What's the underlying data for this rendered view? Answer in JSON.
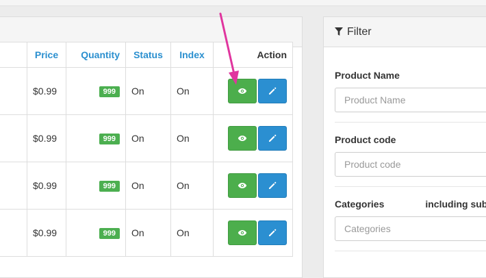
{
  "table": {
    "headers": {
      "price": "Price",
      "quantity": "Quantity",
      "status": "Status",
      "index": "Index",
      "action": "Action"
    },
    "rows": [
      {
        "price": "$0.99",
        "quantity": "999",
        "status": "On",
        "index": "On"
      },
      {
        "price": "$0.99",
        "quantity": "999",
        "status": "On",
        "index": "On"
      },
      {
        "price": "$0.99",
        "quantity": "999",
        "status": "On",
        "index": "On"
      },
      {
        "price": "$0.99",
        "quantity": "999",
        "status": "On",
        "index": "On"
      }
    ]
  },
  "filter": {
    "title": "Filter",
    "product_name": {
      "label": "Product Name",
      "placeholder": "Product Name"
    },
    "product_code": {
      "label": "Product code",
      "placeholder": "Product code"
    },
    "categories": {
      "label": "Categories",
      "sub_label": "including sub",
      "placeholder": "Categories"
    }
  },
  "colors": {
    "link_header": "#2a8fcf",
    "view_button": "#4cae4c",
    "edit_button": "#2b8fd1",
    "badge": "#4caf50",
    "annotation_arrow": "#e0359e"
  },
  "icons": {
    "view": "eye-icon",
    "edit": "pencil-icon",
    "filter": "filter-icon"
  }
}
